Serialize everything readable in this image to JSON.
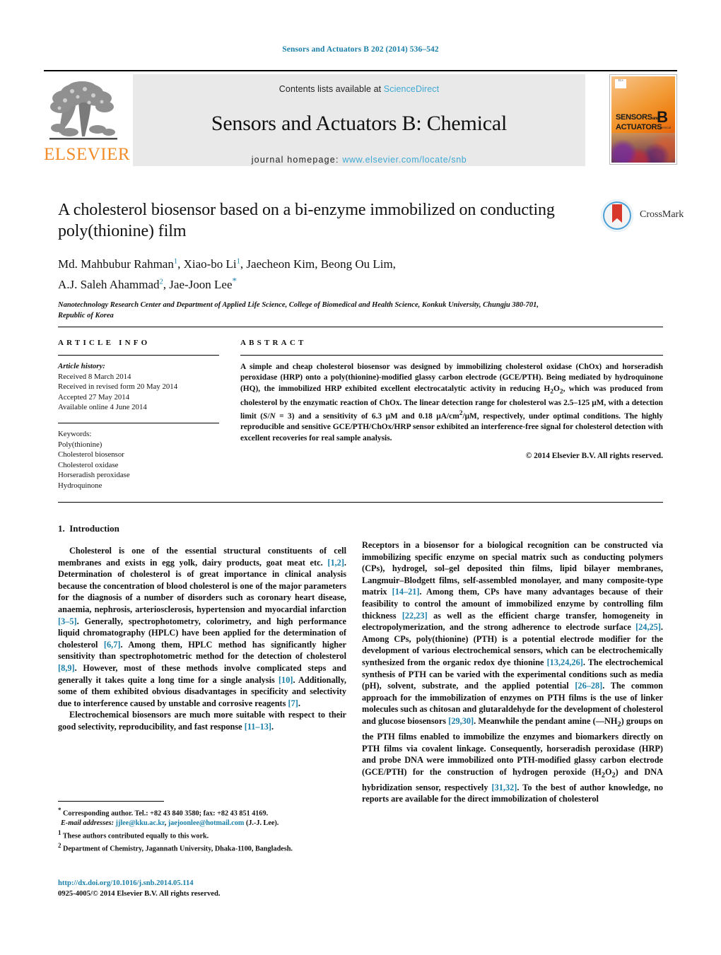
{
  "running_head": "Sensors and Actuators B 202 (2014) 536–542",
  "banner": {
    "contents_prefix": "Contents lists available at ",
    "contents_link": "ScienceDirect",
    "journal_title": "Sensors and Actuators B: Chemical",
    "homepage_prefix": "journal homepage: ",
    "homepage_url": "www.elsevier.com/locate/snb",
    "publisher_logo_text": "ELSEVIER",
    "cover": {
      "line1": "SENSORS",
      "line1_small": "and",
      "line2": "ACTUATORS",
      "volume_letter": "B",
      "volume_sub": "Chemical"
    }
  },
  "crossmark": {
    "label": "CrossMark"
  },
  "article": {
    "title": "A cholesterol biosensor based on a bi-enzyme immobilized on conducting poly(thionine) film",
    "authors_line1": "Md. Mahbubur Rahman",
    "authors_line1_sup": "1",
    "authors_line1_b": ", Xiao-bo Li",
    "authors_line1_sup2": "1",
    "authors_line1_c": ", Jaecheon Kim, Beong Ou Lim,",
    "authors_line2": "A.J. Saleh Ahammad",
    "authors_line2_sup": "2",
    "authors_line2_b": ", Jae-Joon Lee",
    "affiliation": "Nanotechnology Research Center and Department of Applied Life Science, College of Biomedical and Health Science, Konkuk University, Chungju 380-701, Republic of Korea"
  },
  "info": {
    "heading": "ARTICLE INFO",
    "history_label": "Article history:",
    "history": [
      "Received 8 March 2014",
      "Received in revised form 20 May 2014",
      "Accepted 27 May 2014",
      "Available online 4 June 2014"
    ],
    "keywords_label": "Keywords:",
    "keywords": [
      "Poly(thionine)",
      "Cholesterol biosensor",
      "Cholesterol oxidase",
      "Horseradish peroxidase",
      "Hydroquinone"
    ]
  },
  "abstract": {
    "heading": "ABSTRACT",
    "text": "A simple and cheap cholesterol biosensor was designed by immobilizing cholesterol oxidase (ChOx) and horseradish peroxidase (HRP) onto a poly(thionine)-modified glassy carbon electrode (GCE/PTH). Being mediated by hydroquinone (HQ), the immobilized HRP exhibited excellent electrocatalytic activity in reducing H2O2, which was produced from cholesterol by the enzymatic reaction of ChOx. The linear detection range for cholesterol was 2.5–125 μM, with a detection limit (S/N = 3) and a sensitivity of 6.3 μM and 0.18 μA/cm2/μM, respectively, under optimal conditions. The highly reproducible and sensitive GCE/PTH/ChOx/HRP sensor exhibited an interference-free signal for cholesterol detection with excellent recoveries for real sample analysis.",
    "copyright": "© 2014 Elsevier B.V. All rights reserved."
  },
  "introduction": {
    "section_number": "1.",
    "section_title": "Introduction",
    "left_p1": "Cholesterol is one of the essential structural constituents of cell membranes and exists in egg yolk, dairy products, goat meat etc. [1,2]. Determination of cholesterol is of great importance in clinical analysis because the concentration of blood cholesterol is one of the major parameters for the diagnosis of a number of disorders such as coronary heart disease, anaemia, nephrosis, arteriosclerosis, hypertension and myocardial infarction [3–5]. Generally, spectrophotometry, colorimetry, and high performance liquid chromatography (HPLC) have been applied for the determination of cholesterol [6,7]. Among them, HPLC method has significantly higher sensitivity than spectrophotometric method for the detection of cholesterol [8,9]. However, most of these methods involve complicated steps and generally it takes quite a long time for a single analysis [10]. Additionally, some of them exhibited obvious disadvantages in specificity and selectivity due to interference caused by unstable and corrosive reagents [7].",
    "left_p2": "Electrochemical biosensors are much more suitable with respect to their good selectivity, reproducibility, and fast response [11–13].",
    "right_p1": "Receptors in a biosensor for a biological recognition can be constructed via immobilizing specific enzyme on special matrix such as conducting polymers (CPs), hydrogel, sol–gel deposited thin films, lipid bilayer membranes, Langmuir–Blodgett films, self-assembled monolayer, and many composite-type matrix [14–21]. Among them, CPs have many advantages because of their feasibility to control the amount of immobilized enzyme by controlling film thickness [22,23] as well as the efficient charge transfer, homogeneity in electropolymerization, and the strong adherence to electrode surface [24,25]. Among CPs, poly(thionine) (PTH) is a potential electrode modifier for the development of various electrochemical sensors, which can be electrochemically synthesized from the organic redox dye thionine [13,24,26]. The electrochemical synthesis of PTH can be varied with the experimental conditions such as media (pH), solvent, substrate, and the applied potential [26–28]. The common approach for the immobilization of enzymes on PTH films is the use of linker molecules such as chitosan and glutaraldehyde for the development of cholesterol and glucose biosensors [29,30]. Meanwhile the pendant amine (—NH2) groups on the PTH films enabled to immobilize the enzymes and biomarkers directly on PTH films via covalent linkage. Consequently, horseradish peroxidase (HRP) and probe DNA were immobilized onto PTH-modified glassy carbon electrode (GCE/PTH) for the construction of hydrogen peroxide (H2O2) and DNA hybridization sensor, respectively [31,32]. To the best of author knowledge, no reports are available for the direct immobilization of cholesterol"
  },
  "footnotes": {
    "corresponding": "Corresponding author. Tel.: +82 43 840 3580; fax: +82 43 851 4169.",
    "email_label": "E-mail addresses:",
    "email1": "jjlee@kku.ac.kr",
    "email2": "jaejoonlee@hotmail.com",
    "email_suffix": "(J.-J. Lee).",
    "fn1": "These authors contributed equally to this work.",
    "fn2": "Department of Chemistry, Jagannath University, Dhaka-1100, Bangladesh.",
    "fn1_mark": "1",
    "fn2_mark": "2",
    "corr_mark": "*"
  },
  "doi": {
    "url": "http://dx.doi.org/10.1016/j.snb.2014.05.114",
    "issn": "0925-4005/© 2014 Elsevier B.V. All rights reserved."
  },
  "colors": {
    "link": "#1a7fa8",
    "sciencedirect": "#3fa9d4",
    "elsevier_orange": "#F28C28",
    "banner_bg": "#e9e9e9"
  }
}
